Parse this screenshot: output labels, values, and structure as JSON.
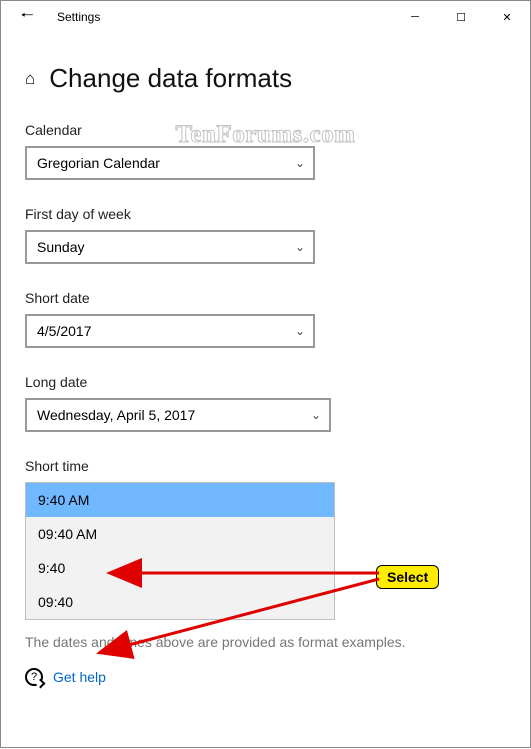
{
  "titlebar": {
    "app_name": "Settings"
  },
  "page": {
    "heading": "Change data formats"
  },
  "fields": {
    "calendar": {
      "label": "Calendar",
      "value": "Gregorian Calendar"
    },
    "first_day": {
      "label": "First day of week",
      "value": "Sunday"
    },
    "short_date": {
      "label": "Short date",
      "value": "4/5/2017"
    },
    "long_date": {
      "label": "Long date",
      "value": "Wednesday, April 5, 2017"
    },
    "short_time": {
      "label": "Short time",
      "options": [
        "9:40 AM",
        "09:40 AM",
        "9:40",
        "09:40"
      ],
      "selected_index": 0
    }
  },
  "note": "The dates and times above are provided as format examples.",
  "help": {
    "label": "Get help"
  },
  "annotation": {
    "badge": "Select"
  },
  "watermark": "TenForums.com"
}
